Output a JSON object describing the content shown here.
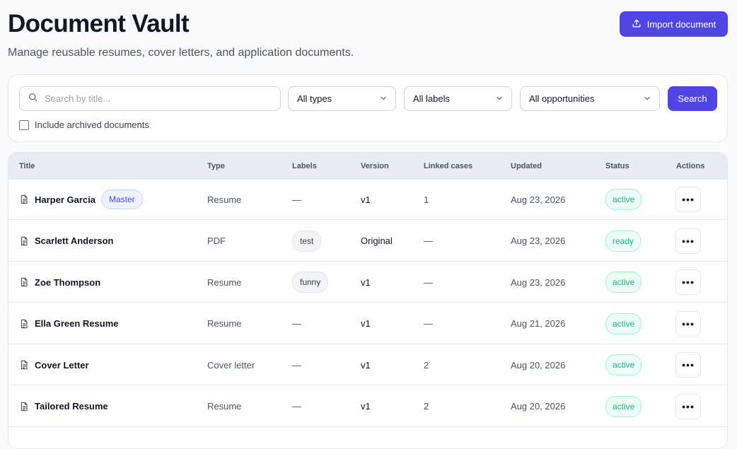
{
  "header": {
    "title": "Document Vault",
    "subtitle": "Manage reusable resumes, cover letters, and application documents.",
    "import_label": "Import document",
    "import_icon": "upload-icon"
  },
  "filters": {
    "search_placeholder": "Search by title...",
    "search_value": "",
    "search_icon": "search-icon",
    "type_value": "All types",
    "labels_value": "All labels",
    "opportunities_value": "All opportunities",
    "search_button": "Search",
    "archived_label": "Include archived documents",
    "archived_checked": false
  },
  "table": {
    "columns": [
      "Title",
      "Type",
      "Labels",
      "Version",
      "Linked cases",
      "Updated",
      "Status",
      "Actions"
    ],
    "rows": [
      {
        "title": "Harper Garcia",
        "badge": "Master",
        "type": "Resume",
        "labels": "—",
        "label_chip": false,
        "version": "v1",
        "linked": "1",
        "updated": "Aug 23, 2026",
        "status": "active",
        "actions": "•••"
      },
      {
        "title": "Scarlett Anderson",
        "badge": "",
        "type": "PDF",
        "labels": "test",
        "label_chip": true,
        "version": "Original",
        "linked": "—",
        "updated": "Aug 23, 2026",
        "status": "ready",
        "actions": "•••"
      },
      {
        "title": "Zoe Thompson",
        "badge": "",
        "type": "Resume",
        "labels": "funny",
        "label_chip": true,
        "version": "v1",
        "linked": "—",
        "updated": "Aug 23, 2026",
        "status": "active",
        "actions": "•••"
      },
      {
        "title": "Ella Green Resume",
        "badge": "",
        "type": "Resume",
        "labels": "—",
        "label_chip": false,
        "version": "v1",
        "linked": "—",
        "updated": "Aug 21, 2026",
        "status": "active",
        "actions": "•••"
      },
      {
        "title": "Cover Letter",
        "badge": "",
        "type": "Cover letter",
        "labels": "—",
        "label_chip": false,
        "version": "v1",
        "linked": "2",
        "updated": "Aug 20, 2026",
        "status": "active",
        "actions": "•••"
      },
      {
        "title": "Tailored Resume",
        "badge": "",
        "type": "Resume",
        "labels": "—",
        "label_chip": false,
        "version": "v1",
        "linked": "2",
        "updated": "Aug 20, 2026",
        "status": "active",
        "actions": "•••"
      }
    ]
  },
  "colors": {
    "accent": "#4f46e5",
    "status_green": "#10b981",
    "header_bg": "#e8edf3"
  }
}
